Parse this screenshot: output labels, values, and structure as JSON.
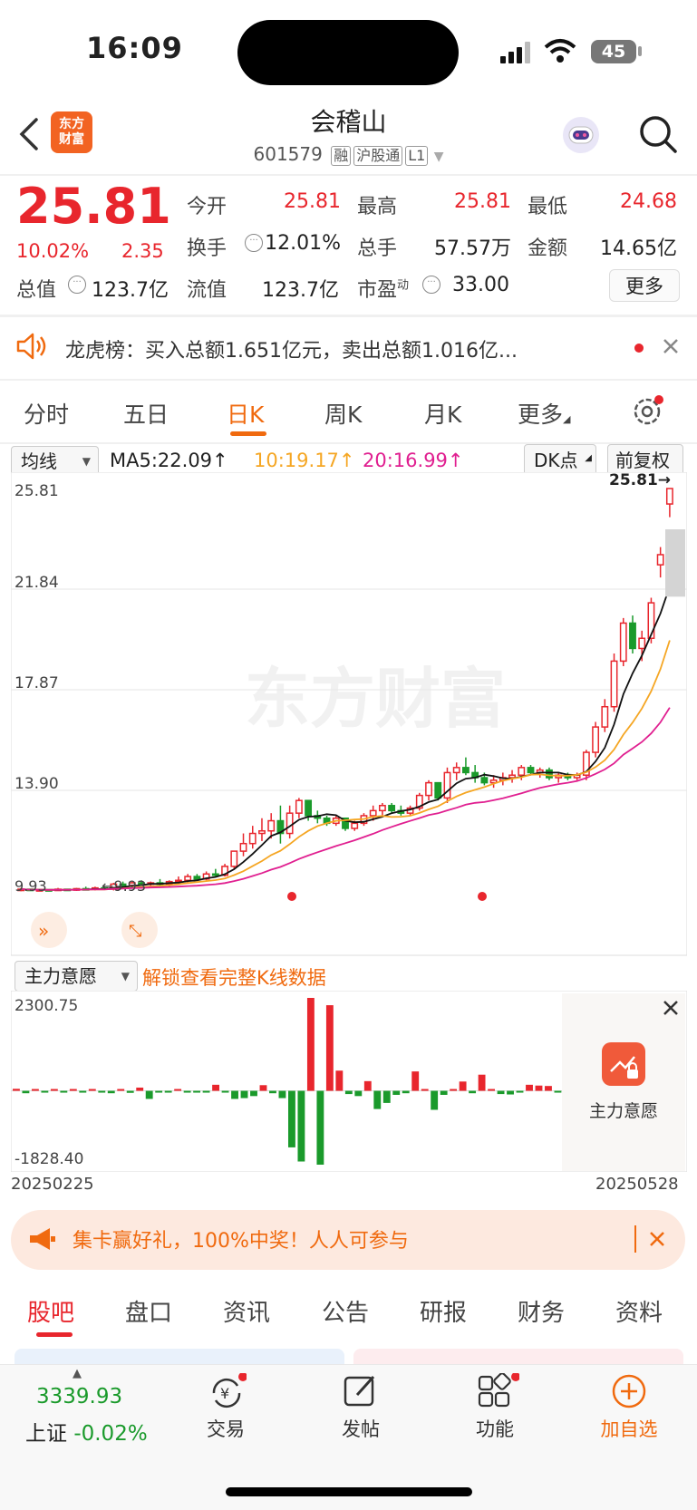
{
  "status": {
    "time": "16:09",
    "battery": "45"
  },
  "header": {
    "logo": "东方\n财富",
    "name": "会稽山",
    "code": "601579",
    "tags": [
      "融",
      "沪股通",
      "L1"
    ]
  },
  "quote": {
    "price": "25.81",
    "change_pct": "10.02%",
    "change": "2.35",
    "rows": [
      [
        {
          "label": "今开",
          "value": "25.81",
          "color": "red"
        },
        {
          "label": "最高",
          "value": "25.81",
          "color": "red"
        },
        {
          "label": "最低",
          "value": "24.68",
          "color": "red"
        }
      ],
      [
        {
          "label": "换手",
          "value": "12.01%",
          "color": "black"
        },
        {
          "label": "总手",
          "value": "57.57万",
          "color": "black"
        },
        {
          "label": "金额",
          "value": "14.65亿",
          "color": "black"
        }
      ],
      [
        {
          "label": "总值",
          "value": "123.7亿",
          "color": "black"
        },
        {
          "label": "流值",
          "value": "123.7亿",
          "color": "black"
        },
        {
          "label": "市盈",
          "value": "33.00",
          "color": "black",
          "sup": "动"
        }
      ]
    ],
    "more_button": "更多"
  },
  "dragon_banner": {
    "text": "龙虎榜：买入总额1.651亿元，卖出总额1.016亿..."
  },
  "kline_tabs": [
    {
      "label": "分时",
      "active": false
    },
    {
      "label": "五日",
      "active": false
    },
    {
      "label": "日K",
      "active": true
    },
    {
      "label": "周K",
      "active": false
    },
    {
      "label": "月K",
      "active": false
    },
    {
      "label": "更多",
      "active": false
    }
  ],
  "chart_toolbar": {
    "indicator": "均线",
    "ma5": "MA5:22.09↑",
    "ma10": "10:19.17↑",
    "ma20": "20:16.99↑",
    "dk": "DK点",
    "adjust": "前复权"
  },
  "chart_data": [
    {
      "type": "candlestick",
      "title": "",
      "y_ticks": [
        "25.81",
        "21.84",
        "17.87",
        "13.90",
        "9.93"
      ],
      "ylim": [
        9.93,
        25.81
      ],
      "last_label": "25.81",
      "min_label": "9.93",
      "candles": [
        [
          10.0,
          10.05,
          9.92,
          10.0
        ],
        [
          10.0,
          10.0,
          9.93,
          9.96
        ],
        [
          9.96,
          10.0,
          9.93,
          9.98
        ],
        [
          9.98,
          10.0,
          9.93,
          9.95
        ],
        [
          9.95,
          10.05,
          9.93,
          10.0
        ],
        [
          10.0,
          10.02,
          9.93,
          9.96
        ],
        [
          9.96,
          10.05,
          9.93,
          10.02
        ],
        [
          10.02,
          10.1,
          9.97,
          10.0
        ],
        [
          10.0,
          10.1,
          9.95,
          10.05
        ],
        [
          10.05,
          10.1,
          9.98,
          10.0
        ],
        [
          10.0,
          10.25,
          9.95,
          10.2
        ],
        [
          10.2,
          10.3,
          10.1,
          10.15
        ],
        [
          10.15,
          10.3,
          10.1,
          10.25
        ],
        [
          10.25,
          10.35,
          10.15,
          10.2
        ],
        [
          10.2,
          10.3,
          10.1,
          10.25
        ],
        [
          10.25,
          10.4,
          10.15,
          10.2
        ],
        [
          10.2,
          10.35,
          10.1,
          10.3
        ],
        [
          10.3,
          10.5,
          10.2,
          10.35
        ],
        [
          10.35,
          10.6,
          10.25,
          10.5
        ],
        [
          10.5,
          10.6,
          10.35,
          10.4
        ],
        [
          10.4,
          10.7,
          10.35,
          10.6
        ],
        [
          10.6,
          10.8,
          10.5,
          10.55
        ],
        [
          10.55,
          11.0,
          10.5,
          10.9
        ],
        [
          10.9,
          11.5,
          10.8,
          11.5
        ],
        [
          11.5,
          12.2,
          11.3,
          11.8
        ],
        [
          11.8,
          12.5,
          11.6,
          12.2
        ],
        [
          12.2,
          12.8,
          11.9,
          12.3
        ],
        [
          12.3,
          13.0,
          12.0,
          12.7
        ],
        [
          12.7,
          13.3,
          11.8,
          12.2
        ],
        [
          12.2,
          13.3,
          12.0,
          13.0
        ],
        [
          13.0,
          13.6,
          12.8,
          13.5
        ],
        [
          13.5,
          13.5,
          12.7,
          12.9
        ],
        [
          12.9,
          13.1,
          12.6,
          12.8
        ],
        [
          12.8,
          12.9,
          12.5,
          12.6
        ],
        [
          12.6,
          12.9,
          12.5,
          12.8
        ],
        [
          12.8,
          12.8,
          12.3,
          12.4
        ],
        [
          12.4,
          12.7,
          12.3,
          12.6
        ],
        [
          12.6,
          13.0,
          12.5,
          12.9
        ],
        [
          12.9,
          13.3,
          12.7,
          13.1
        ],
        [
          13.1,
          13.4,
          12.9,
          13.3
        ],
        [
          13.3,
          13.4,
          13.0,
          13.1
        ],
        [
          13.1,
          13.3,
          12.9,
          13.0
        ],
        [
          13.0,
          13.3,
          12.9,
          13.2
        ],
        [
          13.2,
          13.8,
          13.1,
          13.7
        ],
        [
          13.7,
          14.3,
          13.5,
          14.2
        ],
        [
          14.2,
          14.2,
          13.5,
          13.6
        ],
        [
          13.6,
          14.8,
          13.4,
          14.6
        ],
        [
          14.6,
          15.0,
          14.3,
          14.8
        ],
        [
          14.8,
          15.2,
          14.5,
          14.6
        ],
        [
          14.6,
          14.9,
          14.2,
          14.4
        ],
        [
          14.4,
          14.6,
          14.1,
          14.2
        ],
        [
          14.2,
          14.5,
          14.0,
          14.3
        ],
        [
          14.3,
          14.6,
          14.1,
          14.4
        ],
        [
          14.4,
          14.7,
          14.2,
          14.5
        ],
        [
          14.5,
          14.9,
          14.3,
          14.8
        ],
        [
          14.8,
          14.9,
          14.5,
          14.6
        ],
        [
          14.6,
          14.8,
          14.4,
          14.7
        ],
        [
          14.7,
          14.8,
          14.3,
          14.4
        ],
        [
          14.4,
          14.6,
          14.2,
          14.5
        ],
        [
          14.5,
          14.6,
          14.3,
          14.4
        ],
        [
          14.4,
          14.6,
          14.3,
          14.5
        ],
        [
          14.5,
          15.5,
          14.3,
          15.4
        ],
        [
          15.4,
          16.6,
          15.2,
          16.4
        ],
        [
          16.4,
          17.5,
          16.2,
          17.2
        ],
        [
          17.2,
          19.3,
          17.0,
          19.0
        ],
        [
          19.0,
          20.7,
          18.8,
          20.5
        ],
        [
          20.5,
          20.8,
          19.3,
          19.5
        ],
        [
          19.5,
          20.2,
          19.0,
          19.9
        ],
        [
          19.9,
          21.5,
          19.7,
          21.3
        ],
        [
          22.8,
          23.5,
          22.3,
          23.2
        ],
        [
          25.2,
          25.81,
          24.68,
          25.81
        ]
      ]
    },
    {
      "type": "bar",
      "title": "",
      "series_name": "主力意愿",
      "y_max_label": "2300.75",
      "y_min_label": "-1828.40",
      "ylim": [
        -1828.4,
        2300.75
      ],
      "x_start": "20250225",
      "x_end": "20250528",
      "values": [
        50,
        -60,
        20,
        -40,
        30,
        -20,
        40,
        -10,
        0,
        -20,
        -60,
        30,
        -50,
        80,
        -200,
        -30,
        -10,
        30,
        -40,
        -10,
        -40,
        150,
        -40,
        -200,
        -180,
        -130,
        140,
        -60,
        -180,
        -1400,
        -1750,
        2300.75,
        -1828.4,
        2120,
        500,
        -80,
        -130,
        240,
        -450,
        -300,
        -100,
        -60,
        480,
        0,
        -470,
        -100,
        0,
        230,
        -60,
        400,
        0,
        -80,
        -90,
        -40,
        150,
        130,
        120,
        -40
      ]
    }
  ],
  "fund_panel": {
    "selector": "主力意愿",
    "unlock_text": "解锁查看完整K线数据",
    "overlay_label": "主力意愿"
  },
  "promo": {
    "text": "集卡赢好礼，100%中奖！人人可参与"
  },
  "bottom_tabs": [
    {
      "label": "股吧",
      "active": true
    },
    {
      "label": "盘口",
      "active": false
    },
    {
      "label": "资讯",
      "active": false
    },
    {
      "label": "公告",
      "active": false
    },
    {
      "label": "研报",
      "active": false
    },
    {
      "label": "财务",
      "active": false
    },
    {
      "label": "资料",
      "active": false
    }
  ],
  "bottom_nav": {
    "index_value": "3339.93",
    "index_name": "上证",
    "index_change": "-0.02%",
    "items": [
      {
        "label": "交易",
        "icon": "trade-icon"
      },
      {
        "label": "发帖",
        "icon": "post-icon"
      },
      {
        "label": "功能",
        "icon": "function-icon"
      },
      {
        "label": "加自选",
        "icon": "add-watchlist-icon"
      }
    ]
  },
  "colors": {
    "up": "#e8262d",
    "down": "#1a9a2b",
    "accent": "#f06a0f",
    "ma5": "#111111",
    "ma10": "#f5a623",
    "ma20": "#e01f90"
  },
  "watermark": "东方财富"
}
